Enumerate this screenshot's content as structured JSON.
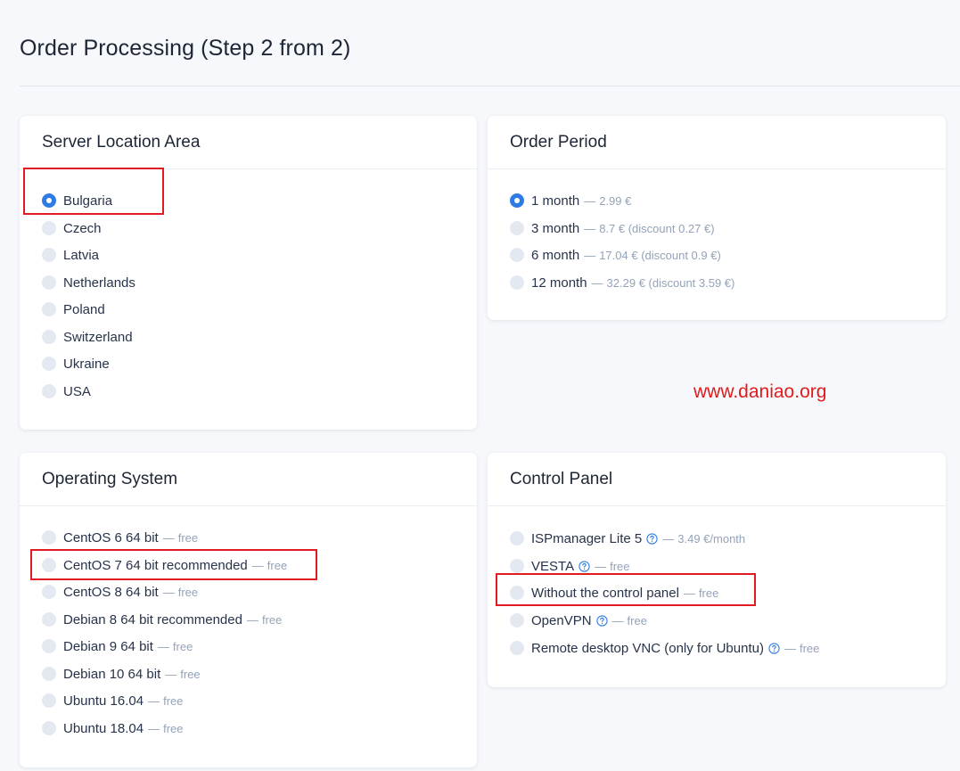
{
  "page": {
    "title": "Order Processing (Step 2 from 2)"
  },
  "location": {
    "title": "Server Location Area",
    "selected": "Bulgaria",
    "options": [
      "Bulgaria",
      "Czech",
      "Latvia",
      "Netherlands",
      "Poland",
      "Switzerland",
      "Ukraine",
      "USA"
    ]
  },
  "period": {
    "title": "Order Period",
    "selected": "1 month",
    "options": [
      {
        "label": "1 month",
        "sep": "—",
        "note": "2.99 €"
      },
      {
        "label": "3 month",
        "sep": "—",
        "note": "8.7 € (discount 0.27 €)"
      },
      {
        "label": "6 month",
        "sep": "—",
        "note": "17.04 € (discount 0.9 €)"
      },
      {
        "label": "12 month",
        "sep": "—",
        "note": "32.29 € (discount 3.59 €)"
      }
    ]
  },
  "os": {
    "title": "Operating System",
    "options": [
      {
        "label": "CentOS 6 64 bit",
        "sep": "—",
        "note": "free"
      },
      {
        "label": "CentOS 7 64 bit recommended",
        "sep": "—",
        "note": "free"
      },
      {
        "label": "CentOS 8 64 bit",
        "sep": "—",
        "note": "free"
      },
      {
        "label": "Debian 8 64 bit recommended",
        "sep": "—",
        "note": "free"
      },
      {
        "label": "Debian 9 64 bit",
        "sep": "—",
        "note": "free"
      },
      {
        "label": "Debian 10 64 bit",
        "sep": "—",
        "note": "free"
      },
      {
        "label": "Ubuntu 16.04",
        "sep": "—",
        "note": "free"
      },
      {
        "label": "Ubuntu 18.04",
        "sep": "—",
        "note": "free"
      }
    ]
  },
  "panel": {
    "title": "Control Panel",
    "options": [
      {
        "label": "ISPmanager Lite 5",
        "sep": "—",
        "note": "3.49 €/month",
        "icon": "help-icon"
      },
      {
        "label": "VESTA",
        "sep": "—",
        "note": "free",
        "icon": "help-icon"
      },
      {
        "label": "Without the control panel",
        "sep": "—",
        "note": "free"
      },
      {
        "label": "OpenVPN",
        "sep": "—",
        "note": "free",
        "icon": "help-icon"
      },
      {
        "label": "Remote desktop VNC (only for Ubuntu)",
        "sep": "—",
        "note": "free",
        "icon": "help-icon"
      }
    ]
  },
  "watermark": "www.daniao.org",
  "colors": {
    "accent": "#2f7be5",
    "highlight": "#e11b22",
    "muted": "#94a3b8"
  }
}
